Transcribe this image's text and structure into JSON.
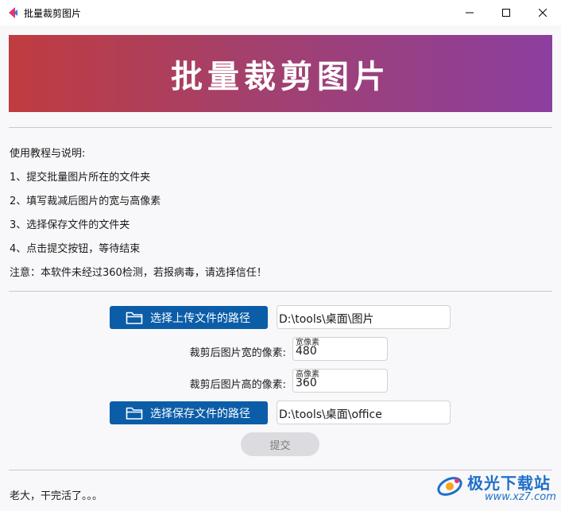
{
  "window": {
    "title": "批量裁剪图片"
  },
  "banner": {
    "title": "批量裁剪图片"
  },
  "instructions": {
    "heading": "使用教程与说明:",
    "step1": "1、提交批量图片所在的文件夹",
    "step2": "2、填写裁减后图片的宽与高像素",
    "step3": "3、选择保存文件的文件夹",
    "step4": "4、点击提交按钮，等待结束",
    "notice": "注意：本软件未经过360检测，若报病毒，请选择信任！"
  },
  "form": {
    "upload_button_label": "选择上传文件的路径",
    "upload_path": "D:\\tools\\桌面\\图片",
    "width_label": "裁剪后图片宽的像素:",
    "width_float_label": "宽像素",
    "width_value": "480",
    "height_label": "裁剪后图片高的像素:",
    "height_float_label": "高像素",
    "height_value": "360",
    "save_button_label": "选择保存文件的路径",
    "save_path": "D:\\tools\\桌面\\office",
    "submit_label": "提交"
  },
  "status": {
    "text": "老大，干完活了。。。"
  },
  "watermark": {
    "name": "极光下载站",
    "url": "www.xz7.com"
  },
  "icons": {
    "app": "app-logo-icon",
    "minimize": "minimize-icon",
    "maximize": "maximize-icon",
    "close": "close-icon",
    "folder": "folder-icon"
  },
  "colors": {
    "banner_start": "#c03c3f",
    "banner_end": "#8c3f9f",
    "button_blue": "#0b5da8",
    "submit_disabled": "#dcdce0"
  }
}
